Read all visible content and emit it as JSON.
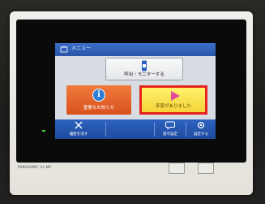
{
  "screen": {
    "title": "メニュー",
    "monitor_button": {
      "label": "呼出・モニターする",
      "icon": "phone-handset-icon"
    },
    "notice_button": {
      "label": "重要なお知らせ",
      "icon": "info-icon",
      "icon_glyph": "i"
    },
    "visitor_button": {
      "label": "来客がありました",
      "icon": "play-icon",
      "highlight_color": "#e6241d"
    },
    "bottom_bar": {
      "items": [
        {
          "label": "履歴を消す",
          "icon": "close-icon"
        },
        {
          "label": "留守設定",
          "icon": "speech-bubble-icon"
        },
        {
          "label": "設定する",
          "icon": "gear-icon"
        }
      ]
    }
  },
  "device": {
    "brand": "PANASONIC  VL-MV"
  },
  "colors": {
    "title_bar": "#2b55a8",
    "notice": "#e0591f",
    "visitor": "#f8e04a",
    "bottom_bar": "#2457b0"
  }
}
